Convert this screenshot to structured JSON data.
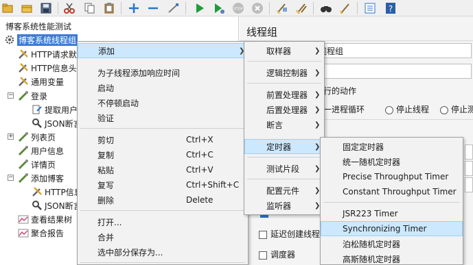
{
  "toolbar": {
    "icons": [
      "new-folder-icon",
      "open-icon",
      "save-icon",
      "cut-icon",
      "copy-icon",
      "paste-icon",
      "add-icon",
      "remove-icon",
      "toggle-icon",
      "start-icon",
      "start-no-pause-icon",
      "stop-icon",
      "shutdown-icon",
      "clear-icon",
      "clear-all-icon",
      "search-icon",
      "reset-search-icon",
      "function-helper-icon",
      "help-icon"
    ]
  },
  "tree": {
    "root": "博客系统性能测试",
    "thread_group": "博客系统线程组",
    "items": [
      {
        "label": "HTTP请求默"
      },
      {
        "label": "HTTP信息头"
      },
      {
        "label": "通用变量"
      },
      {
        "label": "登录"
      },
      {
        "label": "提取用户"
      },
      {
        "label": "JSON断言"
      },
      {
        "label": "列表页"
      },
      {
        "label": "用户信息"
      },
      {
        "label": "详情页"
      },
      {
        "label": "添加博客"
      },
      {
        "label": "HTTP信息"
      },
      {
        "label": "JSON断言"
      },
      {
        "label": "查看结果树"
      },
      {
        "label": "聚合报告"
      }
    ]
  },
  "panel": {
    "title": "线程组",
    "name_value": "线程组",
    "action_label": "执行的动作",
    "radio_next_loop": "下一进程循环",
    "radio_stop_thread": "停止线程",
    "radio_stop_test": "停止测",
    "delay_checkbox": "延迟创建线程",
    "scheduler_checkbox": "调度器"
  },
  "menu1": {
    "items": [
      {
        "label": "添加",
        "shortcut": ""
      },
      {
        "label": "为子线程添加响应时间",
        "shortcut": ""
      },
      {
        "label": "启动",
        "shortcut": ""
      },
      {
        "label": "不停顿启动",
        "shortcut": ""
      },
      {
        "label": "验证",
        "shortcut": ""
      },
      {
        "label": "剪切",
        "shortcut": "Ctrl+X"
      },
      {
        "label": "复制",
        "shortcut": "Ctrl+C"
      },
      {
        "label": "粘贴",
        "shortcut": "Ctrl+V"
      },
      {
        "label": "复写",
        "shortcut": "Ctrl+Shift+C"
      },
      {
        "label": "删除",
        "shortcut": "Delete"
      },
      {
        "label": "打开...",
        "shortcut": ""
      },
      {
        "label": "合并",
        "shortcut": ""
      },
      {
        "label": "选中部分保存为...",
        "shortcut": ""
      }
    ]
  },
  "menu2": {
    "items": [
      {
        "label": "取样器"
      },
      {
        "label": "逻辑控制器"
      },
      {
        "label": "前置处理器"
      },
      {
        "label": "后置处理器"
      },
      {
        "label": "断言"
      },
      {
        "label": "定时器"
      },
      {
        "label": "测试片段"
      },
      {
        "label": "配置元件"
      },
      {
        "label": "监听器"
      }
    ]
  },
  "menu3": {
    "items": [
      {
        "label": "固定定时器"
      },
      {
        "label": "统一随机定时器"
      },
      {
        "label": "Precise Throughput Timer"
      },
      {
        "label": "Constant Throughput Timer"
      },
      {
        "label": "JSR223 Timer"
      },
      {
        "label": "Synchronizing Timer"
      },
      {
        "label": "泊松随机定时器"
      },
      {
        "label": "高斯随机定时器"
      }
    ]
  }
}
